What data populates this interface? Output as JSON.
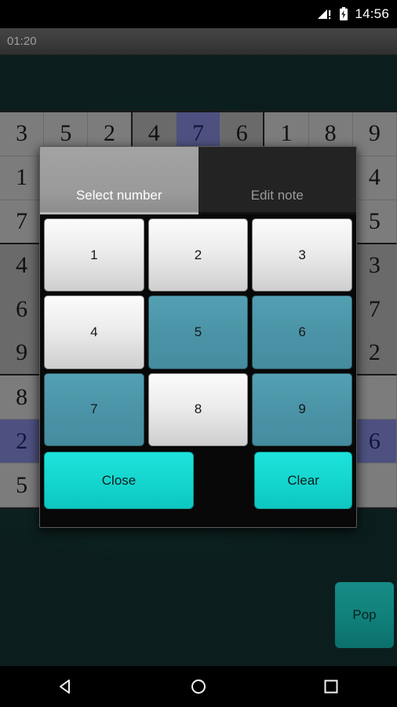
{
  "status_bar": {
    "time": "14:56",
    "signal_icon": "signal-warning-icon",
    "battery_icon": "battery-charging-icon"
  },
  "action_bar": {
    "timer": "01:20"
  },
  "board": {
    "rows": [
      [
        {
          "v": "3",
          "state": "given"
        },
        {
          "v": "5",
          "state": "given"
        },
        {
          "v": "2",
          "state": "given"
        },
        {
          "v": "4",
          "state": "given"
        },
        {
          "v": "7",
          "state": "selected"
        },
        {
          "v": "6",
          "state": "given"
        },
        {
          "v": "1",
          "state": "given"
        },
        {
          "v": "8",
          "state": "given"
        },
        {
          "v": "9",
          "state": "given"
        }
      ],
      [
        {
          "v": "1",
          "state": "given"
        },
        {
          "v": "",
          "state": "empty"
        },
        {
          "v": "",
          "state": "empty"
        },
        {
          "v": "",
          "state": "empty"
        },
        {
          "v": "",
          "state": "empty"
        },
        {
          "v": "",
          "state": "empty"
        },
        {
          "v": "",
          "state": "empty"
        },
        {
          "v": "",
          "state": "empty"
        },
        {
          "v": "4",
          "state": "given"
        }
      ],
      [
        {
          "v": "7",
          "state": "given"
        },
        {
          "v": "",
          "state": "empty"
        },
        {
          "v": "",
          "state": "empty"
        },
        {
          "v": "",
          "state": "empty"
        },
        {
          "v": "",
          "state": "empty"
        },
        {
          "v": "",
          "state": "empty"
        },
        {
          "v": "",
          "state": "empty"
        },
        {
          "v": "",
          "state": "empty"
        },
        {
          "v": "5",
          "state": "given"
        }
      ],
      [
        {
          "v": "4",
          "state": "given"
        },
        {
          "v": "",
          "state": "empty"
        },
        {
          "v": "",
          "state": "empty"
        },
        {
          "v": "",
          "state": "empty"
        },
        {
          "v": "",
          "state": "empty"
        },
        {
          "v": "",
          "state": "empty"
        },
        {
          "v": "",
          "state": "empty"
        },
        {
          "v": "",
          "state": "empty"
        },
        {
          "v": "3",
          "state": "given"
        }
      ],
      [
        {
          "v": "6",
          "state": "given"
        },
        {
          "v": "",
          "state": "empty"
        },
        {
          "v": "",
          "state": "empty"
        },
        {
          "v": "",
          "state": "empty"
        },
        {
          "v": "",
          "state": "empty"
        },
        {
          "v": "",
          "state": "empty"
        },
        {
          "v": "",
          "state": "empty"
        },
        {
          "v": "",
          "state": "empty"
        },
        {
          "v": "7",
          "state": "given"
        }
      ],
      [
        {
          "v": "9",
          "state": "given"
        },
        {
          "v": "",
          "state": "empty"
        },
        {
          "v": "",
          "state": "empty"
        },
        {
          "v": "",
          "state": "empty"
        },
        {
          "v": "",
          "state": "empty"
        },
        {
          "v": "",
          "state": "empty"
        },
        {
          "v": "",
          "state": "empty"
        },
        {
          "v": "",
          "state": "empty"
        },
        {
          "v": "2",
          "state": "given"
        }
      ],
      [
        {
          "v": "8",
          "state": "given"
        },
        {
          "v": "",
          "state": "empty"
        },
        {
          "v": "",
          "state": "empty"
        },
        {
          "v": "",
          "state": "empty"
        },
        {
          "v": "",
          "state": "empty"
        },
        {
          "v": "",
          "state": "empty"
        },
        {
          "v": "",
          "state": "empty"
        },
        {
          "v": "",
          "state": "empty"
        },
        {
          "v": "",
          "state": "empty"
        }
      ],
      [
        {
          "v": "2",
          "state": "selected"
        },
        {
          "v": "",
          "state": "empty"
        },
        {
          "v": "",
          "state": "empty"
        },
        {
          "v": "",
          "state": "empty"
        },
        {
          "v": "",
          "state": "empty"
        },
        {
          "v": "",
          "state": "empty"
        },
        {
          "v": "",
          "state": "empty"
        },
        {
          "v": "",
          "state": "empty"
        },
        {
          "v": "6",
          "state": "selected"
        }
      ],
      [
        {
          "v": "5",
          "state": "given"
        },
        {
          "v": "",
          "state": "empty"
        },
        {
          "v": "",
          "state": "empty"
        },
        {
          "v": "",
          "state": "empty"
        },
        {
          "v": "",
          "state": "empty"
        },
        {
          "v": "",
          "state": "empty"
        },
        {
          "v": "",
          "state": "empty"
        },
        {
          "v": "",
          "state": "empty"
        },
        {
          "v": "",
          "state": "empty"
        }
      ]
    ]
  },
  "dialog": {
    "tabs": [
      {
        "label": "Select number",
        "active": true
      },
      {
        "label": "Edit note",
        "active": false
      }
    ],
    "numbers": [
      {
        "label": "1",
        "used": false
      },
      {
        "label": "2",
        "used": false
      },
      {
        "label": "3",
        "used": false
      },
      {
        "label": "4",
        "used": false
      },
      {
        "label": "5",
        "used": true
      },
      {
        "label": "6",
        "used": true
      },
      {
        "label": "7",
        "used": true
      },
      {
        "label": "8",
        "used": false
      },
      {
        "label": "9",
        "used": true
      }
    ],
    "close_label": "Close",
    "clear_label": "Clear"
  },
  "pop_button": {
    "label": "Pop"
  },
  "nav_bar": {
    "back": "back-icon",
    "home": "home-icon",
    "recents": "recents-icon"
  },
  "colors": {
    "accent_cyan": "#14d5ce",
    "used_teal": "#4b94a7",
    "pop_teal": "#10807a",
    "selected_cell": "#4e5180",
    "background": "#102a28"
  }
}
